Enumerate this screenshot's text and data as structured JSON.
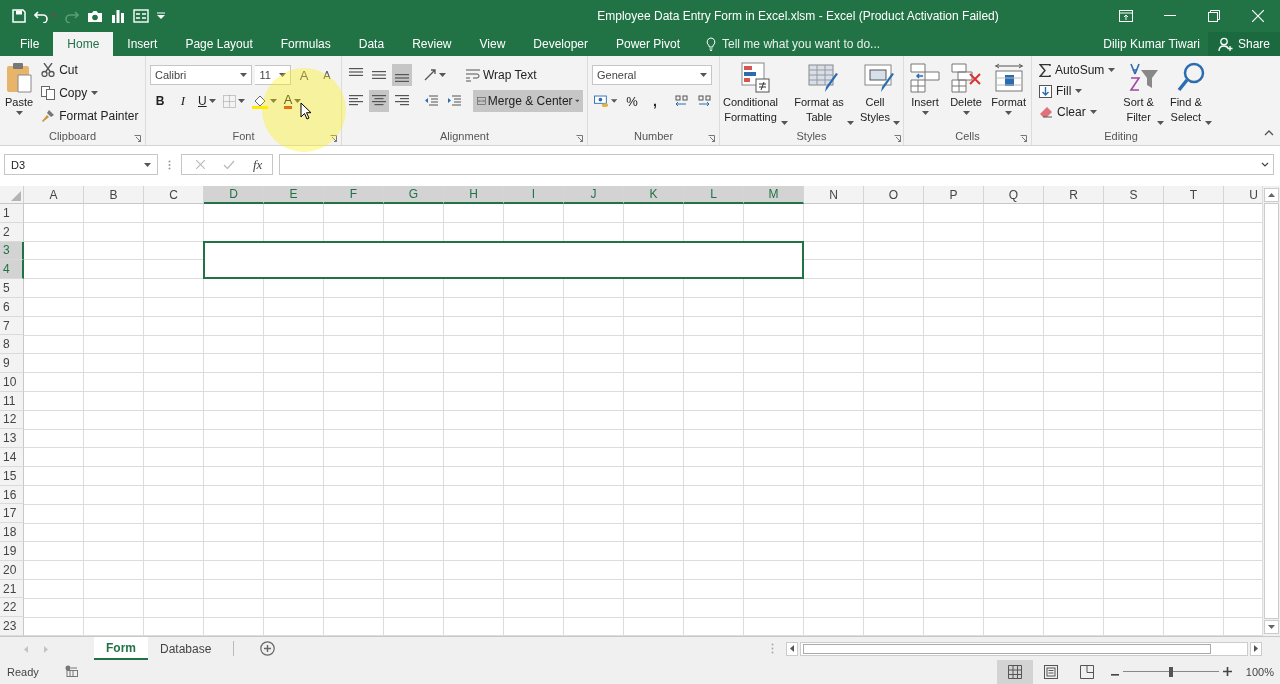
{
  "title_bar": {
    "title": "Employee Data Entry Form in Excel.xlsm - Excel (Product Activation Failed)"
  },
  "tabs": [
    {
      "label": "File",
      "selected": false
    },
    {
      "label": "Home",
      "selected": true
    },
    {
      "label": "Insert",
      "selected": false
    },
    {
      "label": "Page Layout",
      "selected": false
    },
    {
      "label": "Formulas",
      "selected": false
    },
    {
      "label": "Data",
      "selected": false
    },
    {
      "label": "Review",
      "selected": false
    },
    {
      "label": "View",
      "selected": false
    },
    {
      "label": "Developer",
      "selected": false
    },
    {
      "label": "Power Pivot",
      "selected": false
    }
  ],
  "tell_me": "Tell me what you want to do...",
  "user": "Dilip Kumar Tiwari",
  "share": "Share",
  "ribbon": {
    "clipboard": {
      "label": "Clipboard",
      "paste": "Paste",
      "cut": "Cut",
      "copy": "Copy",
      "format_painter": "Format Painter"
    },
    "font": {
      "label": "Font",
      "font_name": "Calibri",
      "font_size": "11",
      "grow": "A",
      "shrink": "A",
      "bold": "B",
      "italic": "I",
      "underline": "U",
      "font_color": "A"
    },
    "alignment": {
      "label": "Alignment",
      "vertical": [
        {
          "kind": "top",
          "selected": false
        },
        {
          "kind": "middle",
          "selected": false
        },
        {
          "kind": "bottom",
          "selected": true
        }
      ],
      "horizontal": [
        {
          "kind": "left",
          "selected": false
        },
        {
          "kind": "center",
          "selected": true
        },
        {
          "kind": "right",
          "selected": false
        }
      ],
      "wrap_text": {
        "label": "Wrap Text",
        "selected": false
      },
      "merge_center": {
        "label": "Merge & Center",
        "selected": true
      }
    },
    "number": {
      "label": "Number",
      "format": "General",
      "percent": "%",
      "comma": ","
    },
    "styles": {
      "label": "Styles",
      "items": [
        {
          "kind": "conditional",
          "label": "Conditional\nFormatting"
        },
        {
          "kind": "table",
          "label": "Format as\nTable"
        },
        {
          "kind": "cell",
          "label": "Cell\nStyles"
        }
      ]
    },
    "cells": {
      "label": "Cells",
      "items": [
        {
          "kind": "insert",
          "label": "Insert"
        },
        {
          "kind": "delete",
          "label": "Delete"
        },
        {
          "kind": "format",
          "label": "Format"
        }
      ]
    },
    "editing": {
      "label": "Editing",
      "autosum": "AutoSum",
      "fill": "Fill",
      "clear": "Clear",
      "sort": "Sort &\nFilter",
      "find": "Find &\nSelect"
    }
  },
  "formula_bar": {
    "name_box": "D3",
    "function_label": "fx"
  },
  "columns": [
    {
      "label": "A",
      "selected": false
    },
    {
      "label": "B",
      "selected": false
    },
    {
      "label": "C",
      "selected": false
    },
    {
      "label": "D",
      "selected": true
    },
    {
      "label": "E",
      "selected": true
    },
    {
      "label": "F",
      "selected": true
    },
    {
      "label": "G",
      "selected": true
    },
    {
      "label": "H",
      "selected": true
    },
    {
      "label": "I",
      "selected": true
    },
    {
      "label": "J",
      "selected": true
    },
    {
      "label": "K",
      "selected": true
    },
    {
      "label": "L",
      "selected": true
    },
    {
      "label": "M",
      "selected": true
    },
    {
      "label": "N",
      "selected": false
    },
    {
      "label": "O",
      "selected": false
    },
    {
      "label": "P",
      "selected": false
    },
    {
      "label": "Q",
      "selected": false
    },
    {
      "label": "R",
      "selected": false
    },
    {
      "label": "S",
      "selected": false
    },
    {
      "label": "T",
      "selected": false
    },
    {
      "label": "U",
      "selected": false
    }
  ],
  "rows": [
    {
      "label": "1",
      "selected": false
    },
    {
      "label": "2",
      "selected": false
    },
    {
      "label": "3",
      "selected": true
    },
    {
      "label": "4",
      "selected": true
    },
    {
      "label": "5",
      "selected": false
    },
    {
      "label": "6",
      "selected": false
    },
    {
      "label": "7",
      "selected": false
    },
    {
      "label": "8",
      "selected": false
    },
    {
      "label": "9",
      "selected": false
    },
    {
      "label": "10",
      "selected": false
    },
    {
      "label": "11",
      "selected": false
    },
    {
      "label": "12",
      "selected": false
    },
    {
      "label": "13",
      "selected": false
    },
    {
      "label": "14",
      "selected": false
    },
    {
      "label": "15",
      "selected": false
    },
    {
      "label": "16",
      "selected": false
    },
    {
      "label": "17",
      "selected": false
    },
    {
      "label": "18",
      "selected": false
    },
    {
      "label": "19",
      "selected": false
    },
    {
      "label": "20",
      "selected": false
    },
    {
      "label": "21",
      "selected": false
    },
    {
      "label": "22",
      "selected": false
    },
    {
      "label": "23",
      "selected": false
    }
  ],
  "sheets": [
    {
      "label": "Form",
      "selected": true
    },
    {
      "label": "Database",
      "selected": false
    }
  ],
  "status_bar": {
    "mode": "Ready",
    "views": [
      {
        "kind": "normal",
        "selected": true
      },
      {
        "kind": "page_layout",
        "selected": false
      },
      {
        "kind": "page_break",
        "selected": false
      }
    ],
    "zoom_slider": {
      "level": 0.5
    },
    "zoom": "100%"
  }
}
